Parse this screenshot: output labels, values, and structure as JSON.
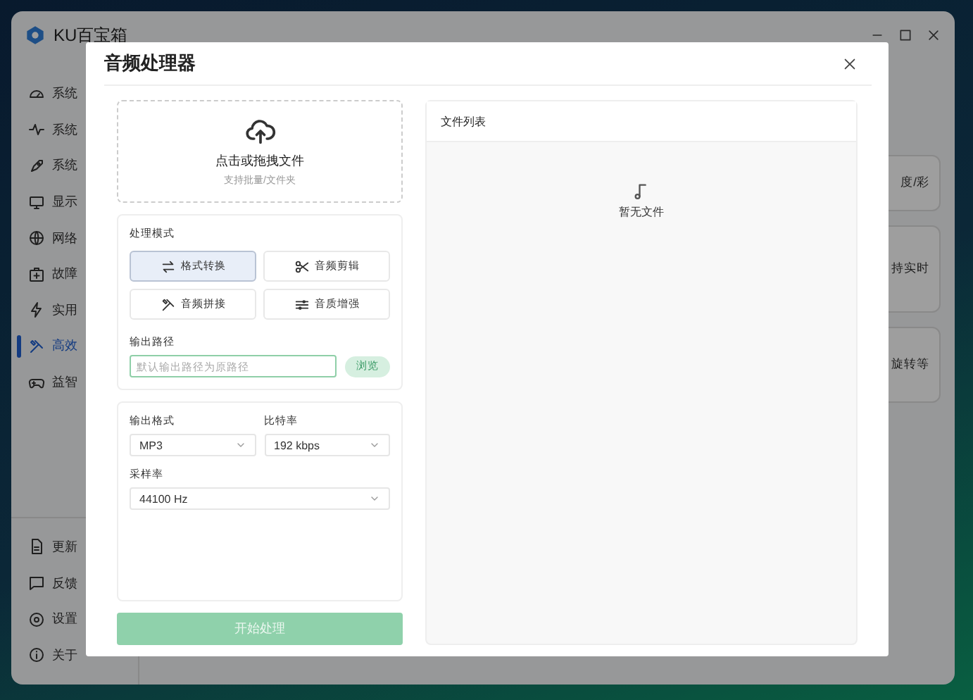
{
  "app": {
    "title": "KU百宝箱"
  },
  "sidebar": {
    "items": [
      {
        "label": "系统",
        "selected": false
      },
      {
        "label": "系统",
        "selected": false
      },
      {
        "label": "系统",
        "selected": false
      },
      {
        "label": "显示",
        "selected": false
      },
      {
        "label": "网络",
        "selected": false
      },
      {
        "label": "故障",
        "selected": false
      },
      {
        "label": "实用",
        "selected": false
      },
      {
        "label": "高效",
        "selected": true
      },
      {
        "label": "益智",
        "selected": false
      }
    ],
    "bottom_items": [
      {
        "label": "更新"
      },
      {
        "label": "反馈"
      },
      {
        "label": "设置"
      },
      {
        "label": "关于"
      }
    ]
  },
  "cards": [
    {
      "text": "度/彩"
    },
    {
      "text": "持实时"
    },
    {
      "text": "旋转等"
    }
  ],
  "dialog": {
    "title": "音频处理器",
    "upload": {
      "title": "点击或拖拽文件",
      "hint": "支持批量/文件夹"
    },
    "mode": {
      "label": "处理模式",
      "options": [
        {
          "label": "格式转换",
          "selected": true
        },
        {
          "label": "音频剪辑",
          "selected": false
        },
        {
          "label": "音频拼接",
          "selected": false
        },
        {
          "label": "音质增强",
          "selected": false
        }
      ]
    },
    "output_path": {
      "label": "输出路径",
      "placeholder": "默认输出路径为原路径",
      "browse": "浏览"
    },
    "settings": [
      {
        "label": "输出格式",
        "value": "MP3"
      },
      {
        "label": "比特率",
        "value": "192 kbps"
      },
      {
        "label": "采样率",
        "value": "44100 Hz"
      }
    ],
    "start_button": {
      "label": "开始处理",
      "disabled": true
    },
    "file_list": {
      "title": "文件列表",
      "empty": "暂无文件"
    }
  }
}
